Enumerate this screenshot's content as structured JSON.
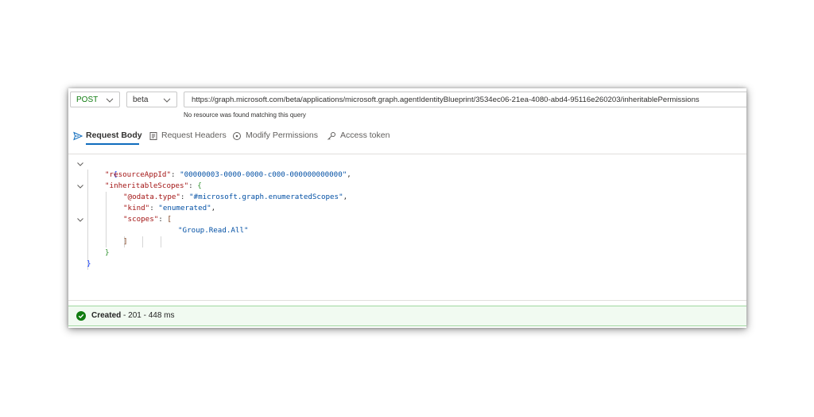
{
  "toolbar": {
    "method": "POST",
    "version": "beta",
    "url": "https://graph.microsoft.com/beta/applications/microsoft.graph.agentIdentityBlueprint/3534ec06-21ea-4080-abd4-95116e260203/inheritablePermissions",
    "hint": "No resource was found matching this query"
  },
  "tabs": {
    "request_body": "Request Body",
    "request_headers": "Request Headers",
    "modify_permissions": "Modify Permissions",
    "access_token": "Access token"
  },
  "code": {
    "l1_open": "{",
    "l2_key": "\"resourceAppId\"",
    "l2_val": "\"00000003-0000-0000-c000-000000000000\"",
    "l3_key": "\"inheritableScopes\"",
    "l3_open": "{",
    "l4_key": "\"@odata.type\"",
    "l4_val": "\"#microsoft.graph.enumeratedScopes\"",
    "l5_key": "\"kind\"",
    "l5_val": "\"enumerated\"",
    "l6_key": "\"scopes\"",
    "l6_open": "[",
    "l7_val": "\"Group.Read.All\"",
    "l8_close": "]",
    "l9_close": "}",
    "l10_close": "}",
    "colon": ": ",
    "comma": ","
  },
  "status": {
    "label": "Created",
    "detail": " - 201 - 448 ms"
  },
  "colors": {
    "method_green": "#107c10",
    "accent_blue": "#0f6cbd",
    "success_green": "#107c10",
    "status_bg": "#f1faf1"
  },
  "icons": [
    "chevron-down-icon",
    "send-icon",
    "headers-icon",
    "shield-icon",
    "key-icon",
    "collapse-chevron-icon",
    "success-check-icon"
  ]
}
